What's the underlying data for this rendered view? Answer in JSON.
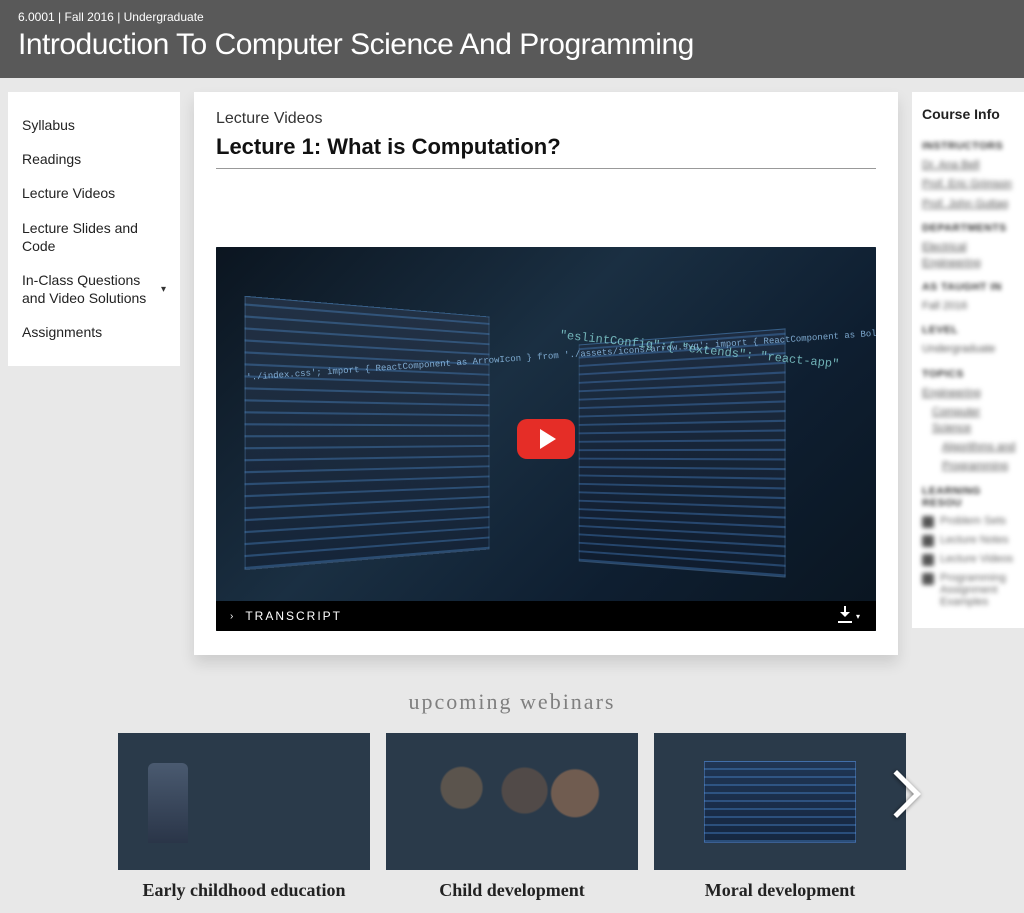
{
  "header": {
    "meta": "6.0001 | Fall 2016 | Undergraduate",
    "title": "Introduction To Computer Science And Programming"
  },
  "sidebar": {
    "items": [
      {
        "label": "Syllabus",
        "expandable": false
      },
      {
        "label": "Readings",
        "expandable": false
      },
      {
        "label": "Lecture Videos",
        "expandable": false
      },
      {
        "label": "Lecture Slides and Code",
        "expandable": false
      },
      {
        "label": "In-Class Questions and Video Solutions",
        "expandable": true
      },
      {
        "label": "Assignments",
        "expandable": false
      }
    ]
  },
  "main": {
    "section": "Lecture Videos",
    "title": "Lecture 1: What is Computation?",
    "transcript_label": "TRANSCRIPT",
    "code_overlay_1": "'./index.css';\nimport { ReactComponent as ArrowIcon } from './assets/icons/arrow.svg';\nimport { ReactComponent as BoltIcon } from './assets/icons/bolt.svg';\nimport { ReactComponent as RightArrowIcon } from './assets/icons/right-arrow.svg';\n\nimport React, { useState, useEffect, useRef } from 'react';\nimport { CSSTransition } from 'react-transition-group';",
    "code_overlay_2": "\"eslintConfig\":{\n\"extends\":\n\"react-app\""
  },
  "info": {
    "heading": "Course Info",
    "instructors_h": "INSTRUCTORS",
    "instructors": [
      "Dr. Ana Bell",
      "Prof. Eric Grimson",
      "Prof. John Guttag"
    ],
    "departments_h": "DEPARTMENTS",
    "departments": "Electrical Engineering",
    "taught_h": "AS TAUGHT IN",
    "taught": "Fall 2016",
    "level_h": "LEVEL",
    "level": "Undergraduate",
    "topics_h": "TOPICS",
    "topics": [
      "Engineering",
      "Computer Science",
      "Algorithms and",
      "Programming"
    ],
    "resources_h": "LEARNING RESOU",
    "resources": [
      "Problem Sets",
      "Lecture Notes",
      "Lecture Videos",
      "Programming Assignment Examples"
    ]
  },
  "webinars": {
    "heading": "upcoming webinars",
    "cards": [
      {
        "caption": "Early childhood education"
      },
      {
        "caption": "Child development"
      },
      {
        "caption": "Moral development"
      }
    ]
  }
}
